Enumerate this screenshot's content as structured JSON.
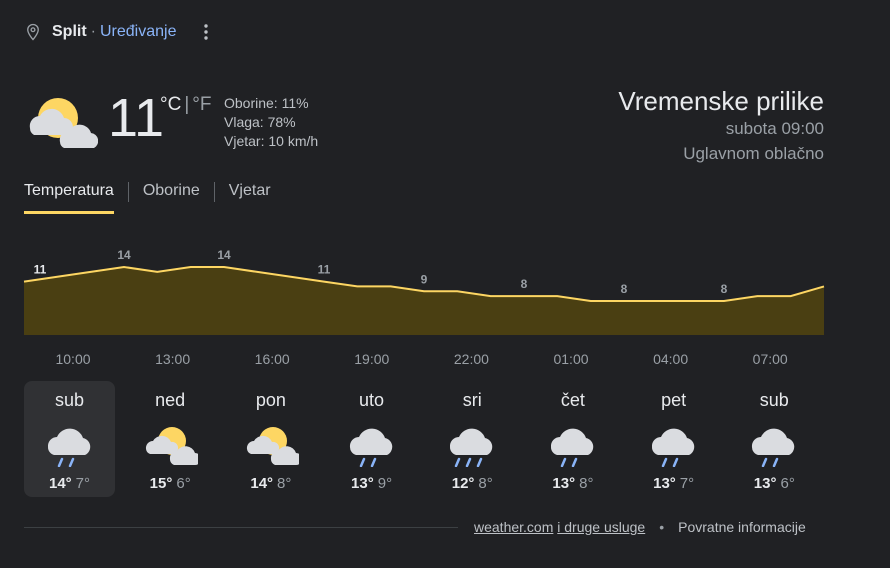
{
  "location": {
    "city": "Split",
    "separator": "·",
    "edit_label": "Uređivanje"
  },
  "current": {
    "icon": "partly-cloudy-icon",
    "temperature": "11",
    "unit_c": "°C",
    "unit_sep": "|",
    "unit_f": "°F",
    "precipitation": "Oborine: 11%",
    "humidity": "Vlaga: 78%",
    "wind": "Vjetar: 10 km/h"
  },
  "summary": {
    "title": "Vremenske prilike",
    "datetime": "subota 09:00",
    "condition": "Uglavnom oblačno"
  },
  "tabs": [
    {
      "label": "Temperatura",
      "active": true
    },
    {
      "label": "Oborine",
      "active": false
    },
    {
      "label": "Vjetar",
      "active": false
    }
  ],
  "chart_data": {
    "type": "area",
    "x": [
      "10:00",
      "11:00",
      "12:00",
      "13:00",
      "14:00",
      "15:00",
      "16:00",
      "17:00",
      "18:00",
      "19:00",
      "20:00",
      "21:00",
      "22:00",
      "23:00",
      "00:00",
      "01:00",
      "02:00",
      "03:00",
      "04:00",
      "05:00",
      "06:00",
      "07:00",
      "08:00",
      "09:00",
      "10:00"
    ],
    "values": [
      11,
      12,
      13,
      14,
      13,
      14,
      14,
      13,
      12,
      11,
      10,
      10,
      9,
      9,
      8,
      8,
      8,
      7,
      7,
      7,
      7,
      7,
      8,
      8,
      10
    ],
    "labels": [
      {
        "index": 0,
        "text": "11"
      },
      {
        "index": 3,
        "text": "14"
      },
      {
        "index": 6,
        "text": "14"
      },
      {
        "index": 9,
        "text": "11"
      },
      {
        "index": 12,
        "text": "9"
      },
      {
        "index": 15,
        "text": "8"
      },
      {
        "index": 18,
        "text": "8"
      },
      {
        "index": 21,
        "text": "8"
      }
    ],
    "tick_labels": [
      "10:00",
      "13:00",
      "16:00",
      "19:00",
      "22:00",
      "01:00",
      "04:00",
      "07:00"
    ],
    "ylim": [
      0,
      14
    ],
    "line_color": "#fdd663",
    "fill_color": "#4a3f12"
  },
  "days": [
    {
      "name": "sub",
      "icon": "rain-icon",
      "high": "14°",
      "low": "7°",
      "selected": true
    },
    {
      "name": "ned",
      "icon": "partly-cloudy-icon",
      "high": "15°",
      "low": "6°",
      "selected": false
    },
    {
      "name": "pon",
      "icon": "partly-cloudy-icon",
      "high": "14°",
      "low": "8°",
      "selected": false
    },
    {
      "name": "uto",
      "icon": "rain-icon",
      "high": "13°",
      "low": "9°",
      "selected": false
    },
    {
      "name": "sri",
      "icon": "showers-icon",
      "high": "12°",
      "low": "8°",
      "selected": false
    },
    {
      "name": "čet",
      "icon": "rain-icon",
      "high": "13°",
      "low": "8°",
      "selected": false
    },
    {
      "name": "pet",
      "icon": "rain-icon",
      "high": "13°",
      "low": "7°",
      "selected": false
    },
    {
      "name": "sub",
      "icon": "rain-icon",
      "high": "13°",
      "low": "6°",
      "selected": false
    }
  ],
  "footer": {
    "source_link": "weather.com",
    "source_rest": "i druge usluge",
    "bullet": "•",
    "feedback": "Povratne informacije"
  }
}
